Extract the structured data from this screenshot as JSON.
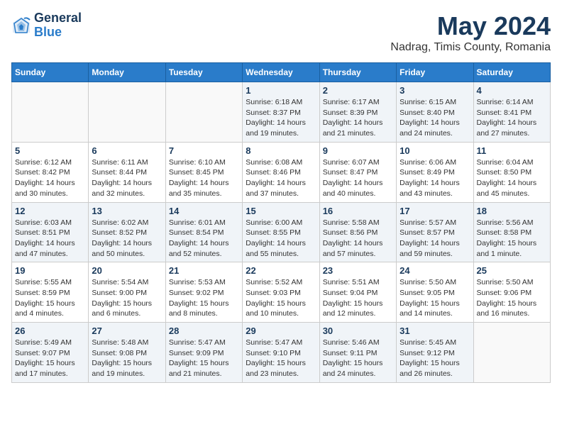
{
  "header": {
    "logo_general": "General",
    "logo_blue": "Blue",
    "title": "May 2024",
    "subtitle": "Nadrag, Timis County, Romania"
  },
  "calendar": {
    "days_of_week": [
      "Sunday",
      "Monday",
      "Tuesday",
      "Wednesday",
      "Thursday",
      "Friday",
      "Saturday"
    ],
    "weeks": [
      [
        {
          "day": "",
          "info": ""
        },
        {
          "day": "",
          "info": ""
        },
        {
          "day": "",
          "info": ""
        },
        {
          "day": "1",
          "info": "Sunrise: 6:18 AM\nSunset: 8:37 PM\nDaylight: 14 hours\nand 19 minutes."
        },
        {
          "day": "2",
          "info": "Sunrise: 6:17 AM\nSunset: 8:39 PM\nDaylight: 14 hours\nand 21 minutes."
        },
        {
          "day": "3",
          "info": "Sunrise: 6:15 AM\nSunset: 8:40 PM\nDaylight: 14 hours\nand 24 minutes."
        },
        {
          "day": "4",
          "info": "Sunrise: 6:14 AM\nSunset: 8:41 PM\nDaylight: 14 hours\nand 27 minutes."
        }
      ],
      [
        {
          "day": "5",
          "info": "Sunrise: 6:12 AM\nSunset: 8:42 PM\nDaylight: 14 hours\nand 30 minutes."
        },
        {
          "day": "6",
          "info": "Sunrise: 6:11 AM\nSunset: 8:44 PM\nDaylight: 14 hours\nand 32 minutes."
        },
        {
          "day": "7",
          "info": "Sunrise: 6:10 AM\nSunset: 8:45 PM\nDaylight: 14 hours\nand 35 minutes."
        },
        {
          "day": "8",
          "info": "Sunrise: 6:08 AM\nSunset: 8:46 PM\nDaylight: 14 hours\nand 37 minutes."
        },
        {
          "day": "9",
          "info": "Sunrise: 6:07 AM\nSunset: 8:47 PM\nDaylight: 14 hours\nand 40 minutes."
        },
        {
          "day": "10",
          "info": "Sunrise: 6:06 AM\nSunset: 8:49 PM\nDaylight: 14 hours\nand 43 minutes."
        },
        {
          "day": "11",
          "info": "Sunrise: 6:04 AM\nSunset: 8:50 PM\nDaylight: 14 hours\nand 45 minutes."
        }
      ],
      [
        {
          "day": "12",
          "info": "Sunrise: 6:03 AM\nSunset: 8:51 PM\nDaylight: 14 hours\nand 47 minutes."
        },
        {
          "day": "13",
          "info": "Sunrise: 6:02 AM\nSunset: 8:52 PM\nDaylight: 14 hours\nand 50 minutes."
        },
        {
          "day": "14",
          "info": "Sunrise: 6:01 AM\nSunset: 8:54 PM\nDaylight: 14 hours\nand 52 minutes."
        },
        {
          "day": "15",
          "info": "Sunrise: 6:00 AM\nSunset: 8:55 PM\nDaylight: 14 hours\nand 55 minutes."
        },
        {
          "day": "16",
          "info": "Sunrise: 5:58 AM\nSunset: 8:56 PM\nDaylight: 14 hours\nand 57 minutes."
        },
        {
          "day": "17",
          "info": "Sunrise: 5:57 AM\nSunset: 8:57 PM\nDaylight: 14 hours\nand 59 minutes."
        },
        {
          "day": "18",
          "info": "Sunrise: 5:56 AM\nSunset: 8:58 PM\nDaylight: 15 hours\nand 1 minute."
        }
      ],
      [
        {
          "day": "19",
          "info": "Sunrise: 5:55 AM\nSunset: 8:59 PM\nDaylight: 15 hours\nand 4 minutes."
        },
        {
          "day": "20",
          "info": "Sunrise: 5:54 AM\nSunset: 9:00 PM\nDaylight: 15 hours\nand 6 minutes."
        },
        {
          "day": "21",
          "info": "Sunrise: 5:53 AM\nSunset: 9:02 PM\nDaylight: 15 hours\nand 8 minutes."
        },
        {
          "day": "22",
          "info": "Sunrise: 5:52 AM\nSunset: 9:03 PM\nDaylight: 15 hours\nand 10 minutes."
        },
        {
          "day": "23",
          "info": "Sunrise: 5:51 AM\nSunset: 9:04 PM\nDaylight: 15 hours\nand 12 minutes."
        },
        {
          "day": "24",
          "info": "Sunrise: 5:50 AM\nSunset: 9:05 PM\nDaylight: 15 hours\nand 14 minutes."
        },
        {
          "day": "25",
          "info": "Sunrise: 5:50 AM\nSunset: 9:06 PM\nDaylight: 15 hours\nand 16 minutes."
        }
      ],
      [
        {
          "day": "26",
          "info": "Sunrise: 5:49 AM\nSunset: 9:07 PM\nDaylight: 15 hours\nand 17 minutes."
        },
        {
          "day": "27",
          "info": "Sunrise: 5:48 AM\nSunset: 9:08 PM\nDaylight: 15 hours\nand 19 minutes."
        },
        {
          "day": "28",
          "info": "Sunrise: 5:47 AM\nSunset: 9:09 PM\nDaylight: 15 hours\nand 21 minutes."
        },
        {
          "day": "29",
          "info": "Sunrise: 5:47 AM\nSunset: 9:10 PM\nDaylight: 15 hours\nand 23 minutes."
        },
        {
          "day": "30",
          "info": "Sunrise: 5:46 AM\nSunset: 9:11 PM\nDaylight: 15 hours\nand 24 minutes."
        },
        {
          "day": "31",
          "info": "Sunrise: 5:45 AM\nSunset: 9:12 PM\nDaylight: 15 hours\nand 26 minutes."
        },
        {
          "day": "",
          "info": ""
        }
      ]
    ]
  }
}
